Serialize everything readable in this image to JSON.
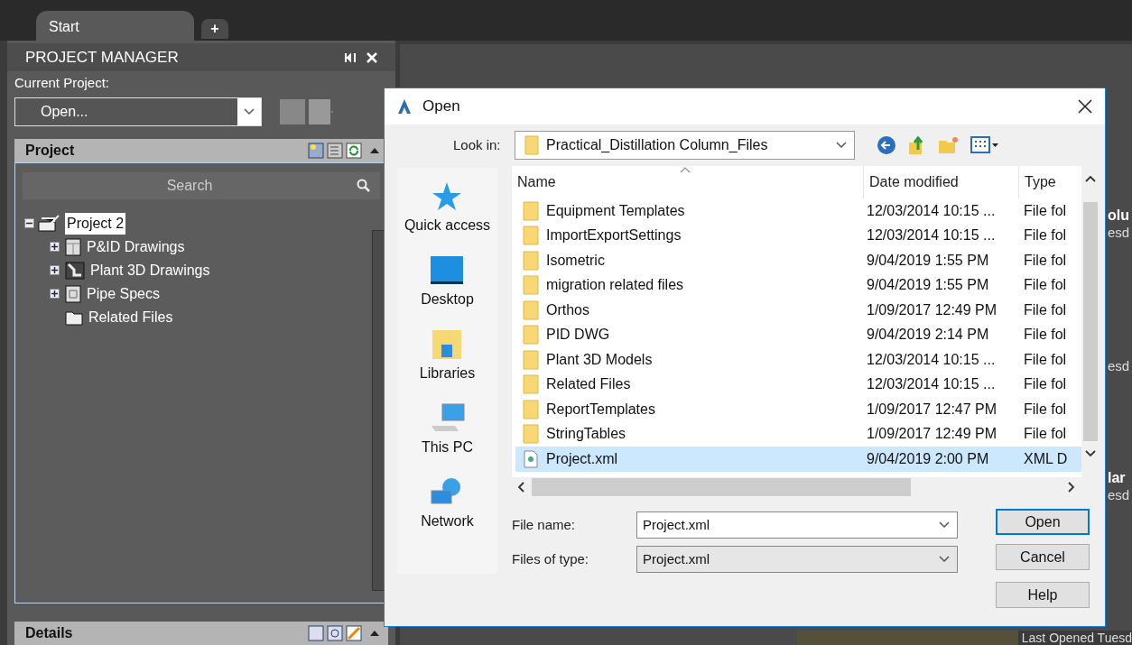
{
  "tabs": [
    {
      "label": "Start",
      "selected": true
    }
  ],
  "new_tab": "+",
  "project_manager": {
    "title": "PROJECT MANAGER",
    "current_project_label": "Current Project:",
    "current_project_value": "Open...",
    "project_section": {
      "title": "Project",
      "search_placeholder": "Search",
      "tree": [
        {
          "label": "Project 2",
          "kind": "project",
          "expanded": true,
          "selected": true,
          "children": [
            {
              "label": "P&ID Drawings",
              "kind": "pid",
              "expandable": true,
              "expanded": false,
              "selected": false
            },
            {
              "label": "Plant 3D Drawings",
              "kind": "plant",
              "expandable": true,
              "expanded": false,
              "selected": false
            },
            {
              "label": "Pipe Specs",
              "kind": "spec",
              "expandable": true,
              "expanded": false,
              "selected": false
            },
            {
              "label": "Related Files",
              "kind": "folder",
              "expandable": false,
              "selected": false
            }
          ]
        }
      ]
    },
    "details_section": {
      "title": "Details"
    }
  },
  "background": {
    "fragments": [
      "olu",
      "esd",
      "esd",
      "lar",
      "esd"
    ],
    "last_opened": "Last Opened Tuesd"
  },
  "dialog": {
    "title": "Open",
    "look_in_label": "Look in:",
    "look_in_value": "Practical_Distillation Column_Files",
    "places": [
      {
        "label": "Quick access",
        "kind": "star"
      },
      {
        "label": "Desktop",
        "kind": "desktop"
      },
      {
        "label": "Libraries",
        "kind": "libraries"
      },
      {
        "label": "This PC",
        "kind": "pc"
      },
      {
        "label": "Network",
        "kind": "network"
      }
    ],
    "columns": [
      "Name",
      "Date modified",
      "Type"
    ],
    "rows": [
      {
        "name": "Equipment Templates",
        "date": "12/03/2014 10:15 ...",
        "type": "File fol",
        "kind": "folder",
        "selected": false
      },
      {
        "name": "ImportExportSettings",
        "date": "12/03/2014 10:15 ...",
        "type": "File fol",
        "kind": "folder",
        "selected": false
      },
      {
        "name": "Isometric",
        "date": "9/04/2019 1:55 PM",
        "type": "File fol",
        "kind": "folder",
        "selected": false
      },
      {
        "name": "migration related files",
        "date": "9/04/2019 1:55 PM",
        "type": "File fol",
        "kind": "folder",
        "selected": false
      },
      {
        "name": "Orthos",
        "date": "1/09/2017 12:49 PM",
        "type": "File fol",
        "kind": "folder",
        "selected": false
      },
      {
        "name": "PID DWG",
        "date": "9/04/2019 2:14 PM",
        "type": "File fol",
        "kind": "folder",
        "selected": false
      },
      {
        "name": "Plant 3D Models",
        "date": "12/03/2014 10:15 ...",
        "type": "File fol",
        "kind": "folder",
        "selected": false
      },
      {
        "name": "Related Files",
        "date": "12/03/2014 10:15 ...",
        "type": "File fol",
        "kind": "folder",
        "selected": false
      },
      {
        "name": "ReportTemplates",
        "date": "1/09/2017 12:47 PM",
        "type": "File fol",
        "kind": "folder",
        "selected": false
      },
      {
        "name": "StringTables",
        "date": "1/09/2017 12:49 PM",
        "type": "File fol",
        "kind": "folder",
        "selected": false
      },
      {
        "name": "Project.xml",
        "date": "9/04/2019 2:00 PM",
        "type": "XML D",
        "kind": "xml",
        "selected": true
      }
    ],
    "file_name_label": "File name:",
    "file_name": "Project.xml",
    "files_of_type_label": "Files of type:",
    "files_of_type": "Project.xml",
    "buttons": [
      {
        "label": "Open",
        "default": true
      },
      {
        "label": "Cancel",
        "default": false
      },
      {
        "label": "Help",
        "default": false
      }
    ]
  }
}
